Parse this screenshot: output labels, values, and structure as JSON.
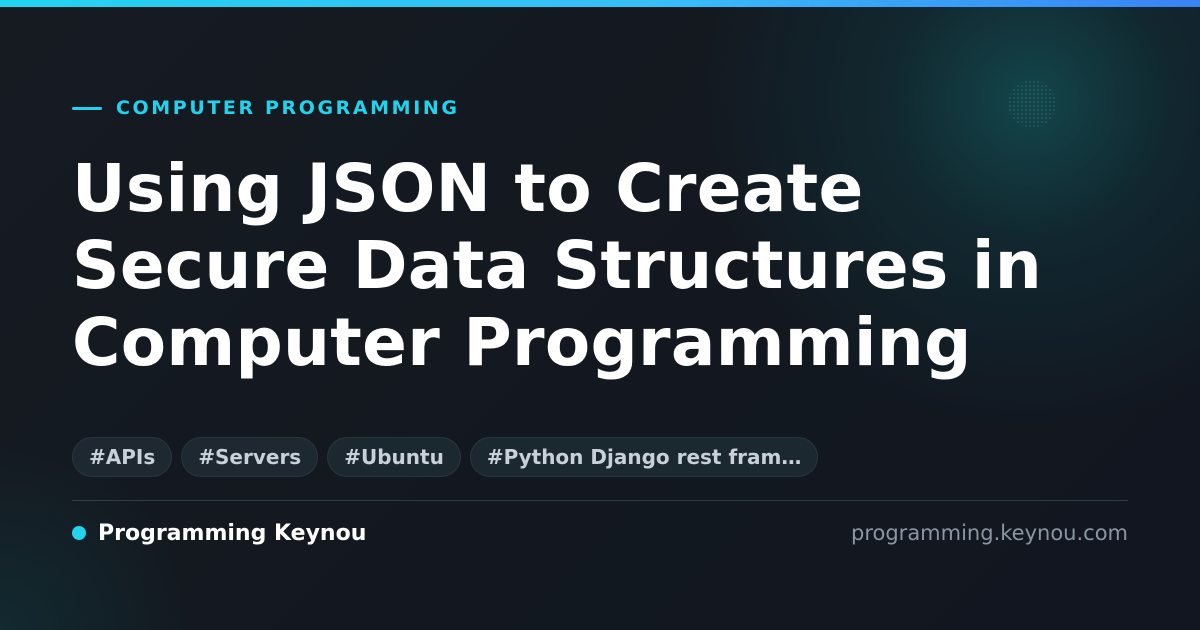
{
  "category": "COMPUTER PROGRAMMING",
  "title_lines": [
    "Using JSON to Create",
    "Secure Data Structures in",
    "Computer Programming"
  ],
  "tags": [
    "#APIs",
    "#Servers",
    "#Ubuntu",
    "#Python Django rest fram…"
  ],
  "brand_name": "Programming Keynou",
  "domain": "programming.keynou.com",
  "colors": {
    "accent": "#22d3ee",
    "background": "#131820",
    "title_text": "#ffffff",
    "tag_text": "#c8d0da",
    "domain_text": "#8c96a3"
  }
}
